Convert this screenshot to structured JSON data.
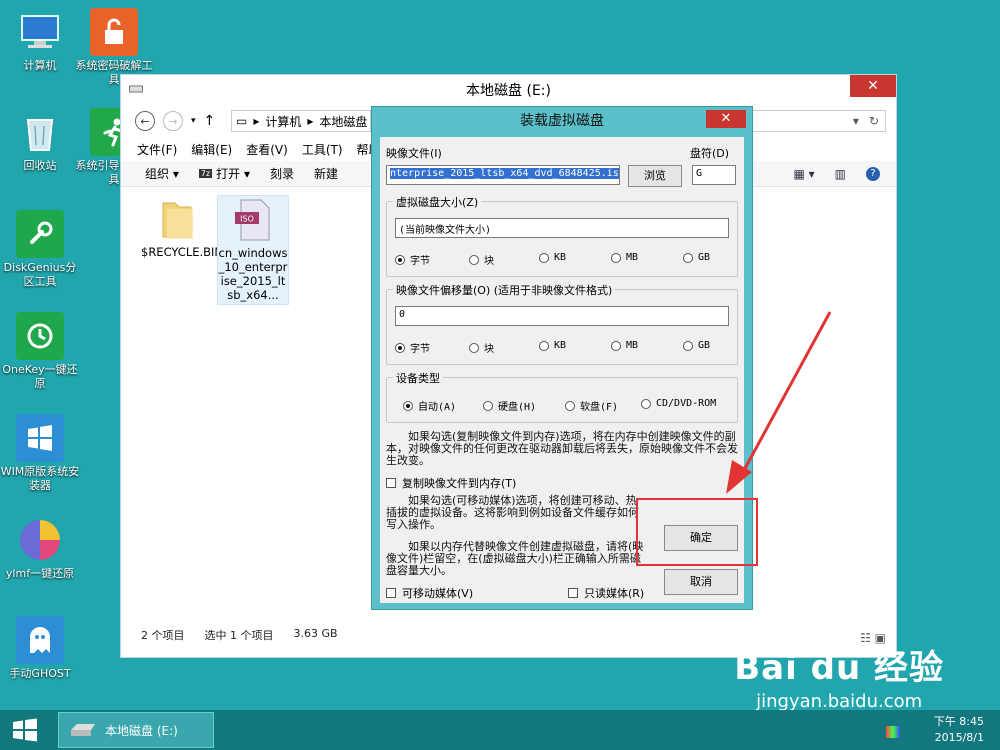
{
  "desktop": {
    "icons": [
      {
        "label": "计算机",
        "icon": "computer-icon"
      },
      {
        "label": "系统密码破解工具",
        "icon": "lock-icon"
      },
      {
        "label": "回收站",
        "icon": "recycle-bin-icon"
      },
      {
        "label": "系统引导修复工具",
        "icon": "runner-icon"
      },
      {
        "label": "DiskGenius分区工具",
        "icon": "wrench-icon"
      },
      {
        "label": "OneKey一键还原",
        "icon": "restore-icon"
      },
      {
        "label": "WIM原版系统安装器",
        "icon": "windows-icon"
      },
      {
        "label": "ylmf一键还原",
        "icon": "pie-icon"
      },
      {
        "label": "手动GHOST",
        "icon": "ghost-icon"
      }
    ]
  },
  "explorer": {
    "title": "本地磁盘 (E:)",
    "breadcrumb": [
      "计算机",
      "本地磁盘"
    ],
    "menu": [
      "文件(F)",
      "编辑(E)",
      "查看(V)",
      "工具(T)",
      "帮助"
    ],
    "toolbar": [
      "组织 ▾",
      "打开 ▾",
      "刻录",
      "新建"
    ],
    "files": [
      {
        "name": "$RECYCLE.BIN",
        "icon": "folder-icon"
      },
      {
        "name": "cn_windows_10_enterprise_2015_ltsb_x64...",
        "icon": "iso-file-icon"
      }
    ],
    "status": {
      "count": "2 个项目",
      "selected": "选中 1 个项目",
      "size": "3.63 GB"
    }
  },
  "dialog": {
    "title": "装载虚拟磁盘",
    "image_file_label": "映像文件(I)",
    "drive_letter_label": "盘符(D)",
    "image_file_value": "nterprise_2015_ltsb_x64_dvd_6848425.iso",
    "browse_label": "浏览",
    "drive_letter_value": "G",
    "vdisk_size_group": "虚拟磁盘大小(Z)",
    "vdisk_size_value": "(当前映像文件大小)",
    "units": [
      "字节",
      "块",
      "KB",
      "MB",
      "GB"
    ],
    "offset_group": "映像文件偏移量(O) (适用于非映像文件格式)",
    "offset_value": "0",
    "device_type_group": "设备类型",
    "device_types": [
      "自动(A)",
      "硬盘(H)",
      "软盘(F)",
      "CD/DVD-ROM"
    ],
    "copy_note": "如果勾选(复制映像文件到内存)选项，将在内存中创建映像文件的副本，对映像文件的任何更改在驱动器卸载后将丢失，原始映像文件不会发生改变。",
    "copy_to_memory_label": "复制映像文件到内存(T)",
    "removable_note": "如果勾选(可移动媒体)选项，将创建可移动、热插拔的虚拟设备。这将影响到例如设备文件缓存如何写入操作。",
    "memory_note": "如果以内存代替映像文件创建虚拟磁盘，请将(映像文件)栏留空，在(虚拟磁盘大小)栏正确输入所需磁盘容量大小。",
    "removable_label": "可移动媒体(V)",
    "readonly_label": "只读媒体(R)",
    "ok_label": "确定",
    "cancel_label": "取消"
  },
  "taskbar": {
    "item_label": "本地磁盘 (E:)",
    "time": "下午 8:45",
    "date": "2015/8/1"
  },
  "watermark": {
    "brand": "Bai du 经验",
    "site": "jingyan.baidu.com"
  },
  "colors": {
    "desktop": "#21a6ad",
    "dialog_frame": "#5bc0ca",
    "highlight": "#e23434",
    "selection": "#3370cf"
  }
}
